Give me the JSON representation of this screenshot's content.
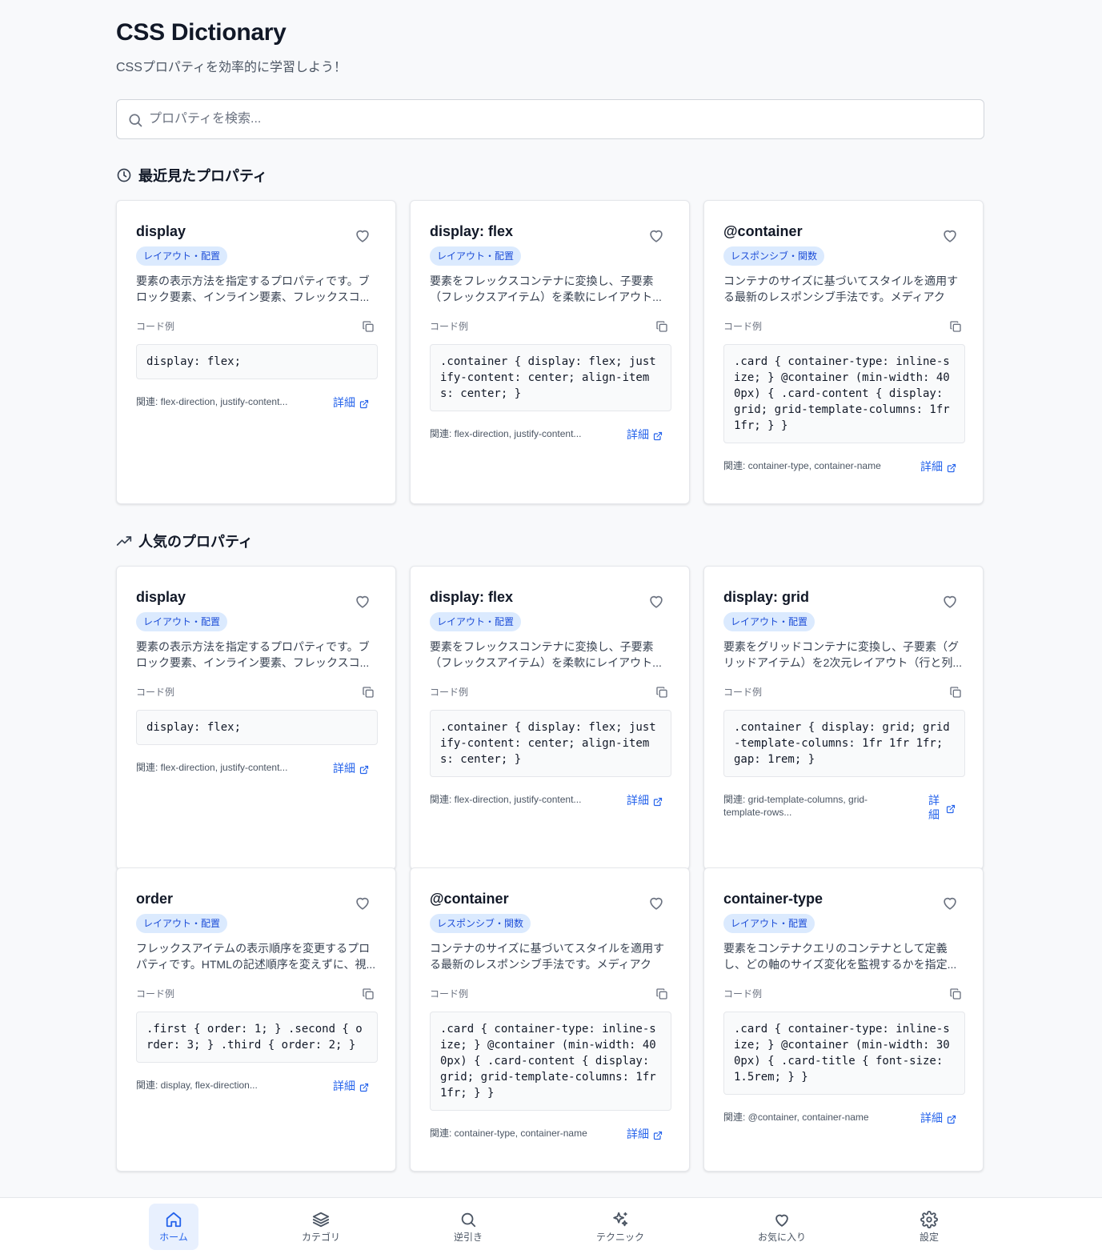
{
  "header": {
    "title": "CSS Dictionary",
    "subtitle": "CSSプロパティを効率的に学習しよう！"
  },
  "search": {
    "placeholder": "プロパティを検索...",
    "value": "",
    "icon": "search-icon"
  },
  "sections": {
    "recent": {
      "title": "最近見たプロパティ",
      "icon": "clock-icon"
    },
    "popular": {
      "title": "人気のプロパティ",
      "icon": "trending-up-icon"
    }
  },
  "labels": {
    "code_example": "コード例",
    "detail": "詳細"
  },
  "colors": {
    "accent": "#2563eb",
    "badge_bg": "#dbeafe",
    "badge_text": "#1d4ed8",
    "background": "#f8f9fb"
  },
  "recent_cards": [
    {
      "title": "display",
      "category": "レイアウト・配置",
      "description": "要素の表示方法を指定するプロパティです。ブロック要素、インライン要素、フレックスコ...",
      "code": "display: flex;",
      "related": "関連: flex-direction, justify-content..."
    },
    {
      "title": "display: flex",
      "category": "レイアウト・配置",
      "description": "要素をフレックスコンテナに変換し、子要素（フレックスアイテム）を柔軟にレイアウト...",
      "code": ".container { display: flex; justify-content: center; align-items: center; }",
      "related": "関連: flex-direction, justify-content..."
    },
    {
      "title": "@container",
      "category": "レスポンシブ・関数",
      "description": "コンテナのサイズに基づいてスタイルを適用する最新のレスポンシブ手法です。メディアクエ...",
      "code": ".card { container-type: inline-size; } @container (min-width: 400px) { .card-content { display: grid; grid-template-columns: 1fr 1fr; } }",
      "related": "関連: container-type, container-name"
    }
  ],
  "popular_cards": [
    {
      "title": "display",
      "category": "レイアウト・配置",
      "description": "要素の表示方法を指定するプロパティです。ブロック要素、インライン要素、フレックスコ...",
      "code": "display: flex;",
      "related": "関連: flex-direction, justify-content..."
    },
    {
      "title": "display: flex",
      "category": "レイアウト・配置",
      "description": "要素をフレックスコンテナに変換し、子要素（フレックスアイテム）を柔軟にレイアウト...",
      "code": ".container { display: flex; justify-content: center; align-items: center; }",
      "related": "関連: flex-direction, justify-content..."
    },
    {
      "title": "display: grid",
      "category": "レイアウト・配置",
      "description": "要素をグリッドコンテナに変換し、子要素（グリッドアイテム）を2次元レイアウト（行と列...",
      "code": ".container { display: grid; grid-template-columns: 1fr 1fr 1fr; gap: 1rem; }",
      "related": "関連: grid-template-columns, grid-template-rows..."
    },
    {
      "title": "order",
      "category": "レイアウト・配置",
      "description": "フレックスアイテムの表示順序を変更するプロパティです。HTMLの記述順序を変えずに、視...",
      "code": ".first { order: 1; } .second { order: 3; } .third { order: 2; }",
      "related": "関連: display, flex-direction..."
    },
    {
      "title": "@container",
      "category": "レスポンシブ・関数",
      "description": "コンテナのサイズに基づいてスタイルを適用する最新のレスポンシブ手法です。メディアクエ...",
      "code": ".card { container-type: inline-size; } @container (min-width: 400px) { .card-content { display: grid; grid-template-columns: 1fr 1fr; } }",
      "related": "関連: container-type, container-name"
    },
    {
      "title": "container-type",
      "category": "レイアウト・配置",
      "description": "要素をコンテナクエリのコンテナとして定義し、どの軸のサイズ変化を監視するかを指定...",
      "code": ".card { container-type: inline-size; } @container (min-width: 300px) { .card-title { font-size: 1.5rem; } }",
      "related": "関連: @container, container-name"
    }
  ],
  "bottom_nav": [
    {
      "label": "ホーム",
      "icon": "home-icon",
      "active": true
    },
    {
      "label": "カテゴリ",
      "icon": "layers-icon",
      "active": false
    },
    {
      "label": "逆引き",
      "icon": "search-icon",
      "active": false
    },
    {
      "label": "テクニック",
      "icon": "sparkles-icon",
      "active": false
    },
    {
      "label": "お気に入り",
      "icon": "heart-icon",
      "active": false
    },
    {
      "label": "設定",
      "icon": "gear-icon",
      "active": false
    }
  ]
}
